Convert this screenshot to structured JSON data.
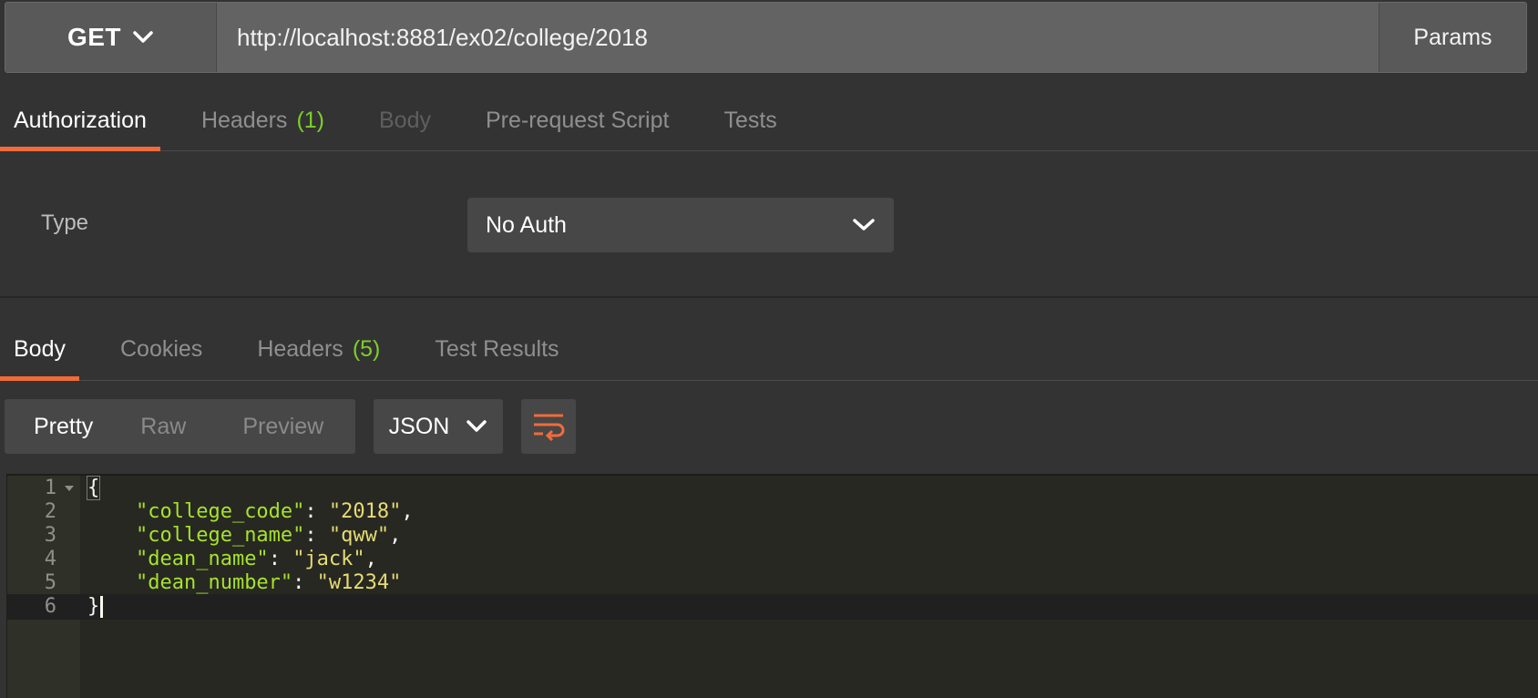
{
  "request": {
    "method": "GET",
    "url": "http://localhost:8881/ex02/college/2018",
    "params_label": "Params"
  },
  "request_tabs": [
    {
      "label": "Authorization",
      "count": "",
      "state": "active"
    },
    {
      "label": "Headers",
      "count": "(1)",
      "state": "normal"
    },
    {
      "label": "Body",
      "count": "",
      "state": "disabled"
    },
    {
      "label": "Pre-request Script",
      "count": "",
      "state": "normal"
    },
    {
      "label": "Tests",
      "count": "",
      "state": "normal"
    }
  ],
  "auth": {
    "type_label": "Type",
    "selected": "No Auth"
  },
  "response_tabs": [
    {
      "label": "Body",
      "count": "",
      "state": "active"
    },
    {
      "label": "Cookies",
      "count": "",
      "state": "normal"
    },
    {
      "label": "Headers",
      "count": "(5)",
      "state": "normal"
    },
    {
      "label": "Test Results",
      "count": "",
      "state": "normal"
    }
  ],
  "response_view": {
    "modes": [
      "Pretty",
      "Raw",
      "Preview"
    ],
    "active_mode": "Pretty",
    "format": "JSON"
  },
  "response_body": {
    "line_numbers": [
      "1",
      "2",
      "3",
      "4",
      "5",
      "6"
    ],
    "open_brace": "{",
    "close_brace": "}",
    "fields": [
      {
        "key": "\"college_code\"",
        "value": "\"2018\"",
        "sep": ","
      },
      {
        "key": "\"college_name\"",
        "value": "\"qww\"",
        "sep": ","
      },
      {
        "key": "\"dean_name\"",
        "value": "\"jack\"",
        "sep": ","
      },
      {
        "key": "\"dean_number\"",
        "value": "\"w1234\"",
        "sep": ""
      }
    ]
  },
  "colors": {
    "accent": "#f26b3a",
    "count_green": "#7fce2a",
    "json_key": "#a6e22e",
    "json_string": "#e6db74",
    "editor_bg": "#272822"
  },
  "icons": {
    "method_dropdown": "chevron-down-icon",
    "auth_dropdown": "chevron-down-icon",
    "format_dropdown": "chevron-down-icon",
    "wrap": "wrap-lines-icon",
    "fold": "fold-triangle-icon"
  }
}
